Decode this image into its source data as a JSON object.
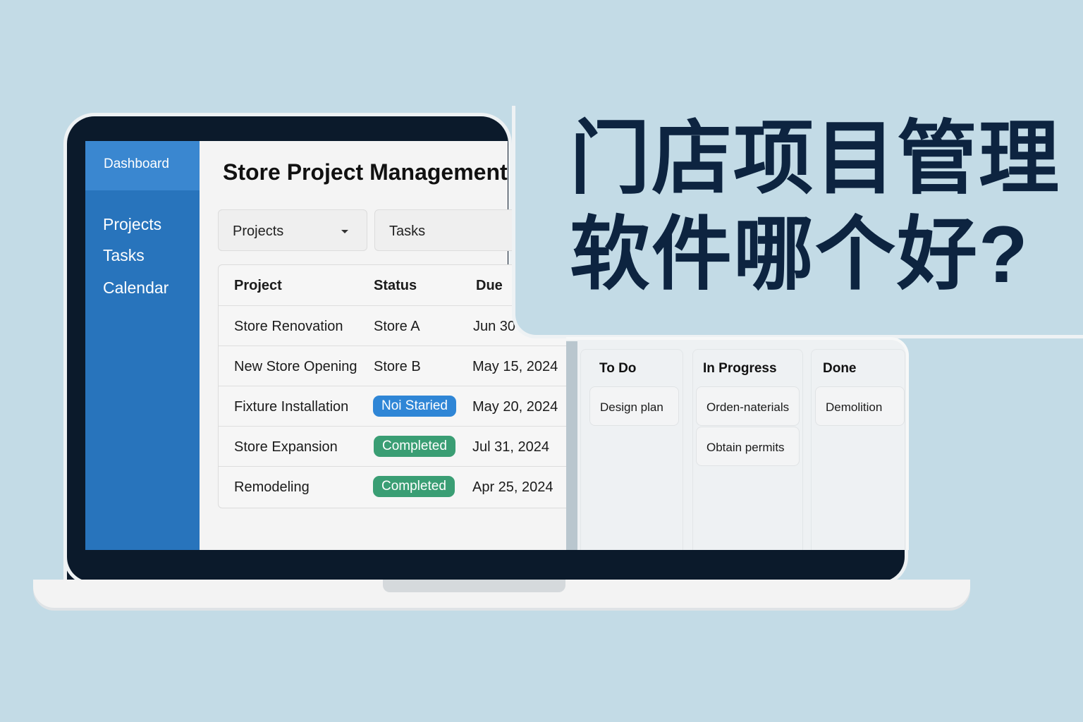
{
  "headline": {
    "line1": "门店项目管理",
    "line2": "软件哪个好?"
  },
  "sidebar": {
    "dashboard": "Dashboard",
    "items": [
      "Projects",
      "Tasks",
      "Calendar"
    ]
  },
  "app": {
    "title": "Store Project Management",
    "dropdown": "Projects",
    "tab": "Tasks"
  },
  "table": {
    "headers": [
      "Project",
      "Status",
      "Due"
    ],
    "rows": [
      {
        "project": "Store Renovation",
        "status": "Store A",
        "due": "Jun 30"
      },
      {
        "project": "New Store Opening",
        "status": "Store B",
        "due": "May 15, 2024"
      },
      {
        "project": "Fixture Installation",
        "status": "Noi Staried",
        "due": "May 20, 2024"
      },
      {
        "project": "Store Expansion",
        "status": "Completed",
        "due": "Jul 31, 2024"
      },
      {
        "project": "Remodeling",
        "status": "Completed",
        "due": "Apr 25, 2024"
      }
    ]
  },
  "kanban": {
    "columns": [
      {
        "title": "To Do",
        "cards": [
          "Design plan"
        ]
      },
      {
        "title": "In Progress",
        "cards": [
          "Orden-naterials",
          "Obtain permits"
        ]
      },
      {
        "title": "Done",
        "cards": [
          "Demolition"
        ]
      }
    ]
  },
  "colors": {
    "blue_badge": "#2f86d6",
    "green_badge": "#3a9e74",
    "sidebar": "#2874bc",
    "headline": "#0d2440"
  }
}
